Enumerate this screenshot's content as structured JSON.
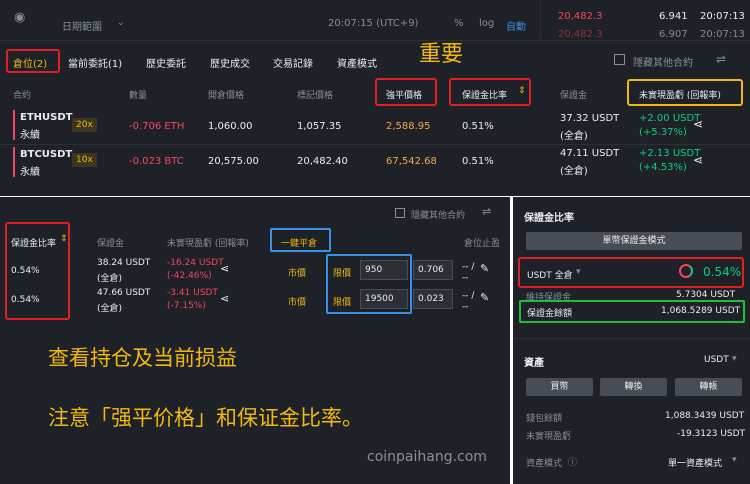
{
  "top": {
    "date_range": "日期範圍",
    "clock": "20:07:15 (UTC+9)",
    "percent": "%",
    "log": "log",
    "auto": "自動",
    "ticker": [
      {
        "price": "20,482.3",
        "qty": "6.941",
        "time": "20:07:13"
      },
      {
        "price": "20,482.3",
        "qty": "6.907",
        "time": "20:07:13"
      }
    ]
  },
  "tabs": [
    {
      "label": "倉位(2)"
    },
    {
      "label": "當前委託(1)"
    },
    {
      "label": "歷史委託"
    },
    {
      "label": "歷史成交"
    },
    {
      "label": "交易記錄"
    },
    {
      "label": "資產模式"
    }
  ],
  "important_label": "重要",
  "hide_other": "隱藏其他合約",
  "columns": [
    "合約",
    "數量",
    "開倉價格",
    "標記價格",
    "強平價格",
    "保證金比率",
    "保證金",
    "未實現盈虧 (回報率)"
  ],
  "positions": [
    {
      "symbol": "ETHUSDT",
      "type": "永續",
      "leverage": "20x",
      "qty": "-0.706 ETH",
      "entry": "1,060.00",
      "mark": "1,057.35",
      "liq": "2,588.95",
      "ratio": "0.51%",
      "margin": "37.32 USDT",
      "margin_mode": "(全倉)",
      "pnl": "+2.00 USDT",
      "roe": "(+5.37%)"
    },
    {
      "symbol": "BTCUSDT",
      "type": "永續",
      "leverage": "10x",
      "qty": "-0.023 BTC",
      "entry": "20,575.00",
      "mark": "20,482.40",
      "liq": "67,542.68",
      "ratio": "0.51%",
      "margin": "47.11 USDT",
      "margin_mode": "(全倉)",
      "pnl": "+2.13 USDT",
      "roe": "(+4.53%)"
    }
  ],
  "lower": {
    "hide_other": "隱藏其他合約",
    "columns": [
      "保證金比率",
      "保證金",
      "未實現盈虧 (回報率)",
      "一鍵平倉",
      "倉位止盈"
    ],
    "rows": [
      {
        "ratio": "0.54%",
        "margin": "38.24 USDT",
        "margin_mode": "(全倉)",
        "pnl": "-16.24 USDT",
        "roe": "(-42.46%)",
        "market": "市價",
        "limit": "限價",
        "price": "950",
        "qty": "0.706",
        "tp": "-- /",
        "sl": "--"
      },
      {
        "ratio": "0.54%",
        "margin": "47.66 USDT",
        "margin_mode": "(全倉)",
        "pnl": "-3.41 USDT",
        "roe": "(-7.15%)",
        "market": "市價",
        "limit": "限價",
        "price": "19500",
        "qty": "0.023",
        "tp": "-- /",
        "sl": "--"
      }
    ],
    "note_line1": "查看持仓及当前损益",
    "note_line2": "注意「强平价格」和保证金比率。",
    "watermark": "coinpaihang.com"
  },
  "side": {
    "title": "保證金比率",
    "mode_button": "單幣保證金模式",
    "account": "USDT 全倉",
    "ratio": "0.54%",
    "maint_label": "維持保證金",
    "maint_value": "5.7304 USDT",
    "balance_label": "保證金餘額",
    "balance_value": "1,068.5289 USDT",
    "assets_title": "資產",
    "asset": "USDT",
    "buttons": [
      "買幣",
      "轉換",
      "轉帳"
    ],
    "wallet_label": "錢包餘額",
    "wallet_value": "1,088.3439 USDT",
    "unreal_label": "未實現盈虧",
    "unreal_value": "-19.3123 USDT",
    "asset_mode_label": "資產模式",
    "asset_mode_value": "單一資產模式"
  },
  "colors": {
    "bg": "#1e2127",
    "red": "#f6465d",
    "green": "#0ecb81",
    "accent": "#f0b90b"
  }
}
